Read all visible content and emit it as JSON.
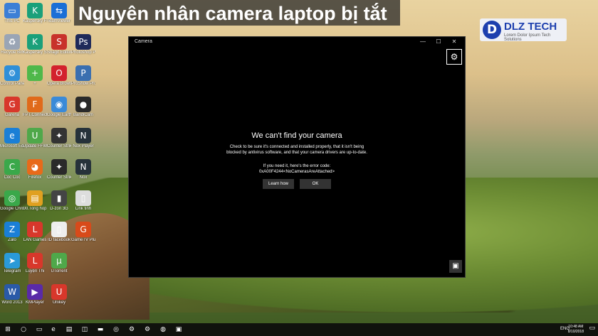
{
  "banner": {
    "title": "Nguyên nhân camera laptop bị tắt"
  },
  "logo": {
    "mark": "D",
    "brand": "DLZ TECH",
    "tagline": "Lorem Dolor Ipsum Tech Solutions"
  },
  "desktop_icons": [
    {
      "label": "This PC",
      "glyph": "▭",
      "color": "#3c7fd6"
    },
    {
      "label": "Kaspersky Free",
      "glyph": "K",
      "color": "#1aa07a"
    },
    {
      "label": "TeamViewer 13",
      "glyph": "⇆",
      "color": "#1a6fd6"
    },
    {
      "label": "Recycle Bin",
      "glyph": "♻",
      "color": "#9aa5b5"
    },
    {
      "label": "Kaspersky Secure Con...",
      "glyph": "K",
      "color": "#1aa07a"
    },
    {
      "label": "Snagit Editor",
      "glyph": "S",
      "color": "#c8322b"
    },
    {
      "label": "Photoshop Portable",
      "glyph": "Ps",
      "color": "#1f2a5a"
    },
    {
      "label": "Control Panel",
      "glyph": "⚙",
      "color": "#2f8fd8"
    },
    {
      "label": "+",
      "glyph": "+",
      "color": "#4fb84a"
    },
    {
      "label": "Opera Browser",
      "glyph": "O",
      "color": "#d3212d"
    },
    {
      "label": "ProShow Producer",
      "glyph": "P",
      "color": "#3a6fb0"
    },
    {
      "label": "Garena",
      "glyph": "G",
      "color": "#d8372b"
    },
    {
      "label": "FPT.Connect...",
      "glyph": "F",
      "color": "#e06a1a"
    },
    {
      "label": "Google Earth Pro",
      "glyph": "◉",
      "color": "#3a8ad8"
    },
    {
      "label": "BandiCam",
      "glyph": "●",
      "color": "#2a2a2a"
    },
    {
      "label": "Microsoft Edge",
      "glyph": "e",
      "color": "#1a7fd6"
    },
    {
      "label": "Update FFW",
      "glyph": "U",
      "color": "#4fa84a"
    },
    {
      "label": "Counter Strike",
      "glyph": "✦",
      "color": "#333333"
    },
    {
      "label": "Nox Player",
      "glyph": "N",
      "color": "#26323a"
    },
    {
      "label": "Cốc Cốc",
      "glyph": "C",
      "color": "#3aa84a"
    },
    {
      "label": "Firefox",
      "glyph": "◕",
      "color": "#e86a1a"
    },
    {
      "label": "Counter Strike 1.6",
      "glyph": "✦",
      "color": "#2a2a2a"
    },
    {
      "label": "Nox",
      "glyph": "N",
      "color": "#26323a"
    },
    {
      "label": "Google Chrome",
      "glyph": "◎",
      "color": "#3aa84a"
    },
    {
      "label": "00.Tong hop",
      "glyph": "▤",
      "color": "#e0a020"
    },
    {
      "label": "D-zon 3G",
      "glyph": "▮",
      "color": "#444444"
    },
    {
      "label": "Link tinh",
      "glyph": "▯",
      "color": "#dddddd"
    },
    {
      "label": "Zalo",
      "glyph": "Z",
      "color": "#1a7fd6"
    },
    {
      "label": "LAN Games",
      "glyph": "L",
      "color": "#d8372b"
    },
    {
      "label": "ID facebook",
      "glyph": "▯",
      "color": "#eeeeee"
    },
    {
      "label": "GameTV Plus",
      "glyph": "G",
      "color": "#d84a1a"
    },
    {
      "label": "Telegram",
      "glyph": "➤",
      "color": "#2a9ad8"
    },
    {
      "label": "Luyện Thi",
      "glyph": "L",
      "color": "#d8372b"
    },
    {
      "label": "UTorrent",
      "glyph": "µ",
      "color": "#4fa84a"
    },
    {
      "label": "Word 2013",
      "glyph": "W",
      "color": "#2a5aa8"
    },
    {
      "label": "KMPlayer",
      "glyph": "▶",
      "color": "#5a2aa8"
    },
    {
      "label": "Unikey",
      "glyph": "U",
      "color": "#d8372b"
    }
  ],
  "camera_window": {
    "title": "Camera",
    "minimize": "—",
    "maximize": "☐",
    "close": "✕",
    "settings_icon": "⚙",
    "heading": "We can't find your camera",
    "body_line1": "Check to be sure it's connected and installed properly, that it isn't being",
    "body_line2": "blocked by antivirus software, and that your camera drivers are up-to-date.",
    "code_label": "If you need it, here's the error code:",
    "error_code": "0xA00F4244<NoCamerasAreAttached>",
    "learn_button": "Learn how",
    "ok_button": "OK",
    "capture_icon": "▣"
  },
  "taskbar": {
    "start": "⊞",
    "search": "○",
    "taskview": "▭",
    "apps": [
      "e",
      "▤",
      "◫",
      "▬",
      "◎",
      "⚙",
      "⚙",
      "◍",
      "▣"
    ],
    "language": "ENG",
    "time": "10:48 AM",
    "date": "8/10/2018",
    "notification": "▭"
  }
}
